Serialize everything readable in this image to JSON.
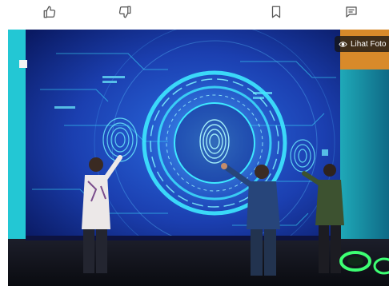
{
  "toolbar": {
    "icons": [
      "thumbs-up-icon",
      "thumbs-down-icon",
      "bookmark-icon",
      "comment-icon"
    ]
  },
  "photo": {
    "view_label": "Lihat Foto",
    "view_icon": "eye-icon"
  },
  "colors": {
    "icon": "#555555",
    "overlay": "#1a1a1a",
    "screen_blue": "#1b3fb0",
    "glow_cyan": "#35e6ff"
  }
}
